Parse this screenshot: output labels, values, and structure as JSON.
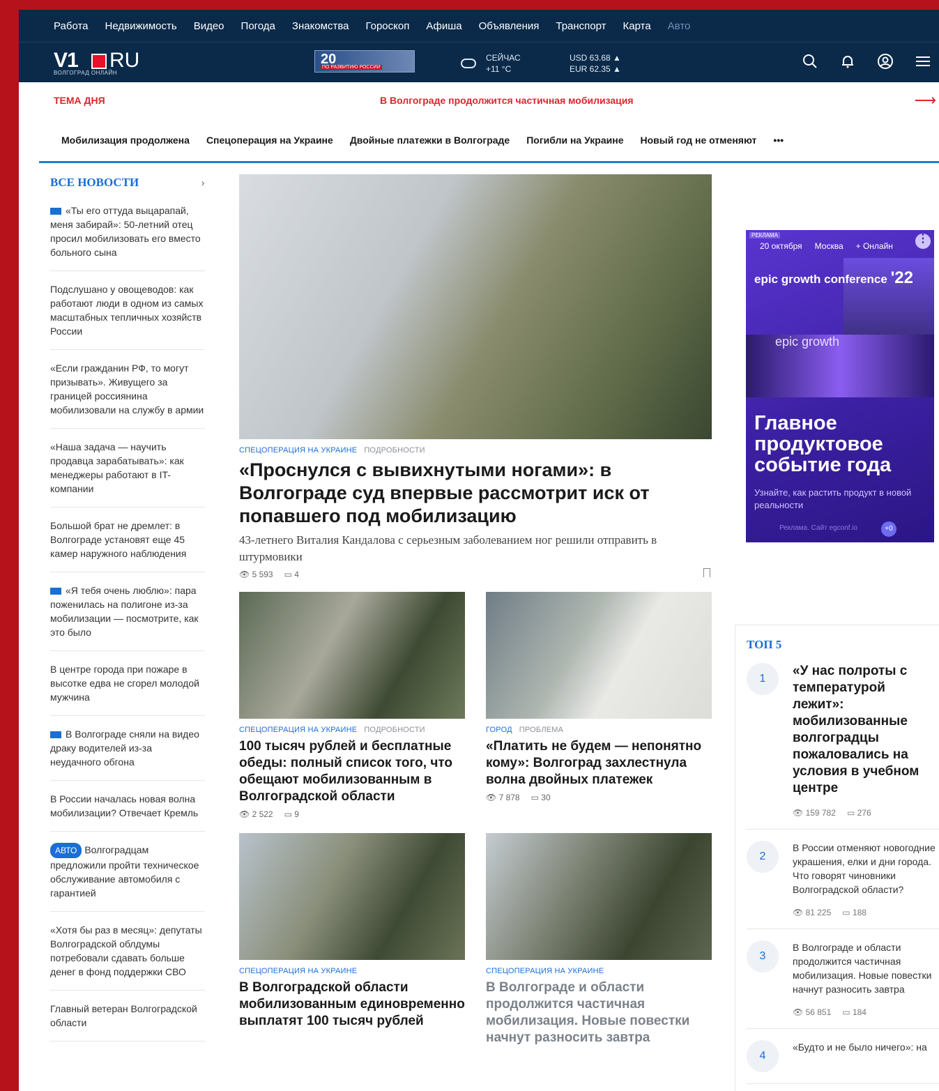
{
  "topnav": [
    "Работа",
    "Недвижимость",
    "Видео",
    "Погода",
    "Знакомства",
    "Гороскоп",
    "Афиша",
    "Объявления",
    "Транспорт",
    "Карта",
    "Авто"
  ],
  "header": {
    "logo_v1": "V1",
    "logo_ru": "RU",
    "logo_sub": "ВОЛГОГРАД ОНЛАЙН",
    "promo_num": "20",
    "promo_txt": "ПО РАЗВИТИЮ РОССИИ",
    "weather_now": "СЕЙЧАС",
    "weather_temp": "+11 °C",
    "usd": "USD 63.68 ▲",
    "eur": "EUR 62.35 ▲"
  },
  "tema": {
    "label": "ТЕМА ДНЯ",
    "text": "В Волгограде продолжится частичная мобилизация",
    "arrow": "⟶"
  },
  "tags": [
    "Мобилизация продолжена",
    "Спецоперация на Украине",
    "Двойные платежки в Волгограде",
    "Погибли на Украине",
    "Новый год не отменяют",
    "•••"
  ],
  "left": {
    "header": "ВСЕ НОВОСТИ",
    "items": [
      {
        "video": true,
        "text": "«Ты его оттуда выцарапай, меня забирай»: 50-летний отец просил мобилизовать его вместо больного сына"
      },
      {
        "text": "Подслушано у овощеводов: как работают люди в одном из самых масштабных тепличных хозяйств России"
      },
      {
        "text": "«Если гражданин РФ, то могут призывать». Живущего за границей россиянина мобилизовали на службу в армии"
      },
      {
        "text": "«Наша задача — научить продавца зарабатывать»: как менеджеры работают в IT-компании"
      },
      {
        "text": "Большой брат не дремлет: в Волгограде установят еще 45 камер наружного наблюдения"
      },
      {
        "video": true,
        "text": "«Я тебя очень люблю»: пара поженилась на полигоне из-за мобилизации — посмотрите, как это было"
      },
      {
        "text": "В центре города при пожаре в высотке едва не сгорел молодой мужчина"
      },
      {
        "video": true,
        "text": "В Волгограде сняли на видео драку водителей из-за неудачного обгона"
      },
      {
        "text": "В России началась новая волна мобилизации? Отвечает Кремль"
      },
      {
        "badge": "АВТО",
        "text": "Волгоградцам предложили пройти техническое обслуживание автомобиля с гарантией"
      },
      {
        "text": "«Хотя бы раз в месяц»: депутаты Волгоградской облдумы потребовали сдавать больше денег в фонд поддержки СВО"
      },
      {
        "text": "Главный ветеран Волгоградской области"
      }
    ]
  },
  "hero": {
    "cat": "СПЕЦОПЕРАЦИЯ НА УКРАИНЕ",
    "cat2": "ПОДРОБНОСТИ",
    "title": "«Проснулся с вывихнутыми ногами»: в Волгограде суд впервые рассмотрит иск от попавшего под мобилизацию",
    "lead": "43-летнего Виталия Кандалова с серьезным заболеванием ног решили отправить в штурмовики",
    "views": "5 593",
    "comments": "4"
  },
  "cards": [
    {
      "cat": "СПЕЦОПЕРАЦИЯ НА УКРАИНЕ",
      "cat2": "ПОДРОБНОСТИ",
      "title": "100 тысяч рублей и бесплатные обеды: полный список того, что обещают мобилизованным в Волгоградской области",
      "views": "2 522",
      "comments": "9"
    },
    {
      "cat": "ГОРОД",
      "cat2": "ПРОБЛЕМА",
      "title": "«Платить не будем — непонятно кому»: Волгоград захлестнула волна двойных платежек",
      "views": "7 878",
      "comments": "30"
    },
    {
      "cat": "СПЕЦОПЕРАЦИЯ НА УКРАИНЕ",
      "cat2": "",
      "title": "В Волгоградской области мобилизованным единовременно выплатят 100 тысяч рублей",
      "views": "",
      "comments": ""
    },
    {
      "cat": "СПЕЦОПЕРАЦИЯ НА УКРАИНЕ",
      "cat2": "",
      "title": "В Волгограде и области продолжится частичная мобилизация. Новые повестки начнут разносить завтра",
      "views": "",
      "comments": ""
    }
  ],
  "ad": {
    "label": "РЕКЛАМА",
    "date": "20 октября",
    "city": "Москва",
    "online": "+ Онлайн",
    "epic": "epic growth conference",
    "year": "'22",
    "brand": "epic growth",
    "headline": "Главное продуктовое событие года",
    "sub": "Узнайте, как растить продукт в новой реальности",
    "foot": "Реклама. Сайт egconf.io",
    "plus": "+0"
  },
  "top5": {
    "header": "ТОП 5",
    "items": [
      {
        "n": "1",
        "title": "«У нас полроты с температурой лежит»: мобилизованные волгоградцы пожаловались на условия в учебном центре",
        "views": "159 782",
        "comments": "276"
      },
      {
        "n": "2",
        "title": "В России отменяют новогодние украшения, елки и дни города. Что говорят чиновники Волгоградской области?",
        "views": "81 225",
        "comments": "188"
      },
      {
        "n": "3",
        "title": "В Волгограде и области продолжится частичная мобилизация. Новые повестки начнут разносить завтра",
        "views": "56 851",
        "comments": "184"
      },
      {
        "n": "4",
        "title": "«Будто и не было ничего»: на",
        "views": "",
        "comments": ""
      }
    ]
  }
}
